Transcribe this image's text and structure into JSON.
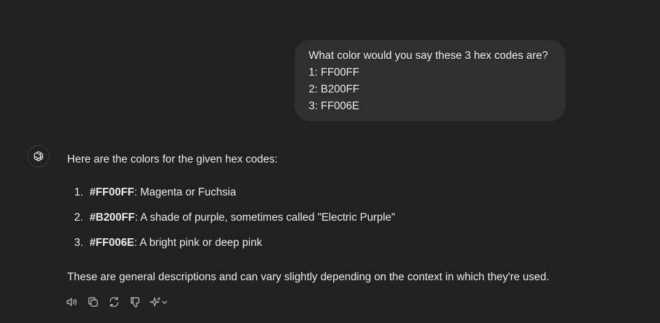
{
  "user_message": {
    "lines": [
      "What color would you say these 3 hex codes are?",
      "1: FF00FF",
      "2: B200FF",
      "3: FF006E"
    ]
  },
  "assistant": {
    "avatar_icon": "chatgpt-logo-icon",
    "intro": "Here are the colors for the given hex codes:",
    "items": [
      {
        "num": "1.",
        "code": "#FF00FF",
        "desc": ": Magenta or Fuchsia"
      },
      {
        "num": "2.",
        "code": "#B200FF",
        "desc": ": A shade of purple, sometimes called \"Electric Purple\""
      },
      {
        "num": "3.",
        "code": "#FF006E",
        "desc": ": A bright pink or deep pink"
      }
    ],
    "outro": "These are general descriptions and can vary slightly depending on the context in which they're used."
  },
  "actions": {
    "icons": [
      "read-aloud-icon",
      "copy-icon",
      "regenerate-icon",
      "thumbs-down-icon",
      "change-model-icon"
    ]
  },
  "colors": {
    "background": "#212121",
    "bubble": "#2f2f2f",
    "text": "#ececec",
    "icon": "#b4b4b4"
  }
}
